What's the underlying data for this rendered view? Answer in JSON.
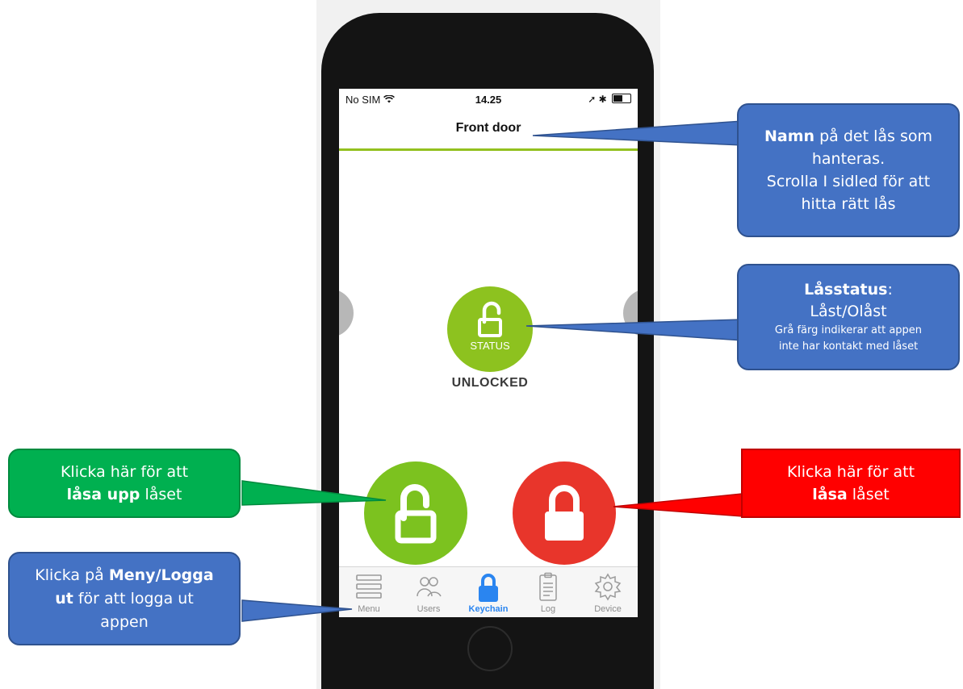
{
  "status_bar": {
    "carrier": "No SIM",
    "time": "14.25"
  },
  "nav": {
    "title": "Front door"
  },
  "lock_status": {
    "badge_label": "STATUS",
    "state_text": "UNLOCKED"
  },
  "tabs": [
    {
      "label": "Menu",
      "icon": "menu-icon",
      "active": false
    },
    {
      "label": "Users",
      "icon": "users-icon",
      "active": false
    },
    {
      "label": "Keychain",
      "icon": "padlock-icon",
      "active": true
    },
    {
      "label": "Log",
      "icon": "clipboard-icon",
      "active": false
    },
    {
      "label": "Device",
      "icon": "gear-icon",
      "active": false
    }
  ],
  "callouts": {
    "name": {
      "bold": "Namn",
      "line1_rest": " på det lås som",
      "line2": "hanteras.",
      "line3": "Scrolla I sidled för att",
      "line4": "hitta rätt lås"
    },
    "status": {
      "bold": "Låsstatus",
      "line1_rest": ":",
      "line2": "Låst/Olåst",
      "line3": "Grå färg indikerar att appen",
      "line4": "inte har kontakt med låset"
    },
    "unlock": {
      "line1": "Klicka här för att",
      "bold": "låsa upp",
      "line2_rest": " låset"
    },
    "lock": {
      "line1": "Klicka här för att",
      "bold": "låsa",
      "line2_rest": " låset"
    },
    "menu": {
      "line1_pre": "Klicka på ",
      "bold1": "Meny/Logga",
      "bold2": "ut",
      "line2_rest": " för att logga ut",
      "line3": "appen"
    }
  },
  "colors": {
    "accent_green": "#8dc21f",
    "lock_red": "#e8352b",
    "tab_active": "#2a85f0",
    "callout_blue": "#4472c4",
    "callout_green": "#00b050",
    "callout_red": "#ff0000"
  }
}
